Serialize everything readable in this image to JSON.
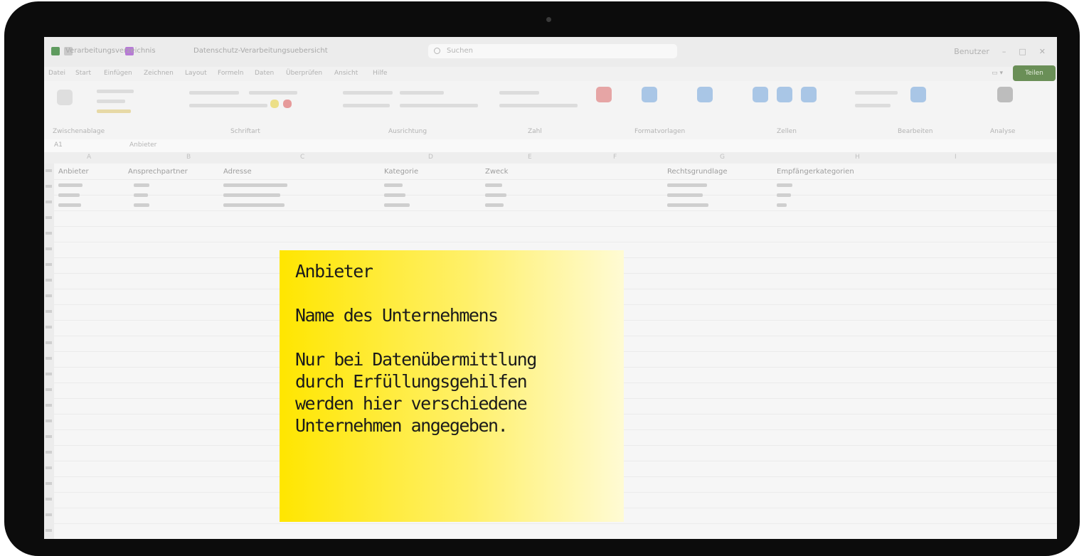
{
  "window": {
    "title_left": "Verarbeitungsverzeichnis",
    "doc_name": "Datenschutz-Verarbeitungsuebersicht",
    "search_placeholder": "Suchen",
    "user": "Benutzer"
  },
  "menu": {
    "tabs": [
      "Datei",
      "Start",
      "Einfügen",
      "Zeichnen",
      "Layout",
      "Formeln",
      "Daten",
      "Überprüfen",
      "Ansicht",
      "Hilfe"
    ],
    "share_label": "Teilen"
  },
  "ribbon": {
    "groups": [
      {
        "label": "Zwischenablage"
      },
      {
        "label": "Schriftart"
      },
      {
        "label": "Ausrichtung"
      },
      {
        "label": "Zahl"
      },
      {
        "label": "Formatvorlagen"
      },
      {
        "label": "Zellen"
      },
      {
        "label": "Bearbeiten"
      },
      {
        "label": "Analyse"
      }
    ]
  },
  "formula": {
    "cell_ref": "A1",
    "content": "Anbieter"
  },
  "sheet": {
    "columns": [
      "A",
      "B",
      "C",
      "D",
      "E",
      "F",
      "G",
      "H",
      "I"
    ],
    "headers": [
      "Anbieter",
      "Ansprechpartner",
      "Adresse",
      "Kategorie",
      "Zweck",
      "Rechtsgrundlage",
      "Empfängerkategorien"
    ]
  },
  "note": {
    "title": "Anbieter",
    "line1": "Name des Unternehmens",
    "line2": "Nur bei Datenübermittlung",
    "line3": "durch Erfüllungsgehilfen",
    "line4": "werden hier verschiedene",
    "line5": "Unternehmen angegeben."
  },
  "colors": {
    "note_yellow": "#ffe600",
    "share_green": "#6a8f57",
    "bezel": "#0c0c0c"
  }
}
